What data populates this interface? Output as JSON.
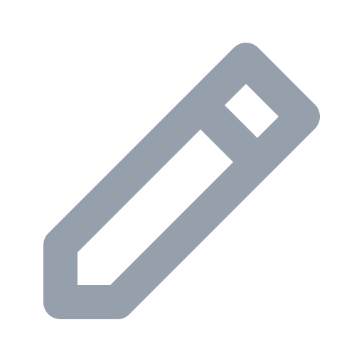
{
  "icon": {
    "name": "pencil-icon",
    "color": "#969fac",
    "background": "#ffffff"
  }
}
